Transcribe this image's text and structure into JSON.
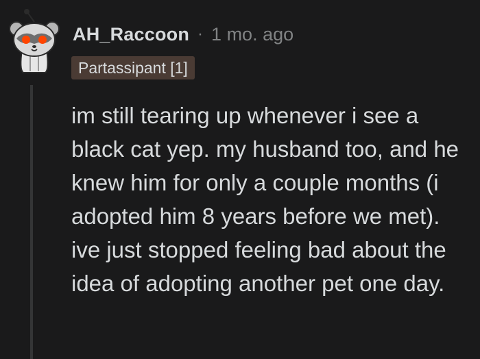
{
  "comment": {
    "author": "AH_Raccoon",
    "separator": "·",
    "timestamp": "1 mo. ago",
    "flair": "Partassipant [1]",
    "body": "im still tearing up whenever i see a black cat yep. my husband too, and he knew him for only a couple months (i adopted him 8 years before we met). ive just stopped feeling bad about the idea of adopting another pet one day.",
    "avatar_icon": "raccoon-snoo-avatar-icon"
  },
  "colors": {
    "background": "#1a1a1b",
    "text": "#d7dadc",
    "meta": "#818384",
    "flair_bg": "#4a3b34",
    "thread_line": "#343536"
  }
}
